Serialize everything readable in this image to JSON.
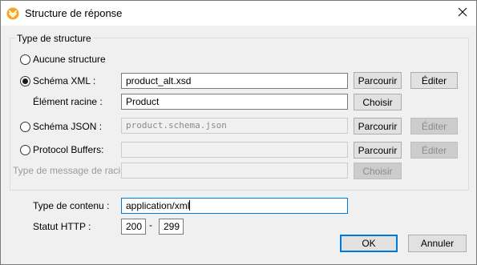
{
  "window": {
    "title": "Structure de réponse"
  },
  "structure_group": {
    "title": "Type de structure",
    "options": {
      "none": {
        "label": "Aucune structure",
        "selected": false
      },
      "xml": {
        "label": "Schéma XML :",
        "selected": true,
        "value": "product_alt.xsd",
        "browse_label": "Parcourir",
        "edit_label": "Éditer"
      },
      "root_element": {
        "label": "Élément racine :",
        "value": "Product",
        "choose_label": "Choisir"
      },
      "json": {
        "label": "Schéma JSON :",
        "selected": false,
        "value": "product.schema.json",
        "browse_label": "Parcourir",
        "edit_label": "Éditer"
      },
      "protobuf": {
        "label": "Protocol Buffers:",
        "selected": false,
        "value": "",
        "browse_label": "Parcourir",
        "edit_label": "Éditer"
      },
      "root_message": {
        "label": "Type de message de racine",
        "value": "",
        "choose_label": "Choisir"
      }
    }
  },
  "content_type": {
    "label": "Type de contenu :",
    "value": "application/xml"
  },
  "http_status": {
    "label": "Statut HTTP :",
    "from": "200",
    "separator": "-",
    "to": "299"
  },
  "buttons": {
    "ok": "OK",
    "cancel": "Annuler"
  },
  "colors": {
    "accent": "#0078d7",
    "icon_orange": "#f5a623"
  },
  "icons": {
    "app": "altova-app-icon",
    "close": "close-icon"
  }
}
